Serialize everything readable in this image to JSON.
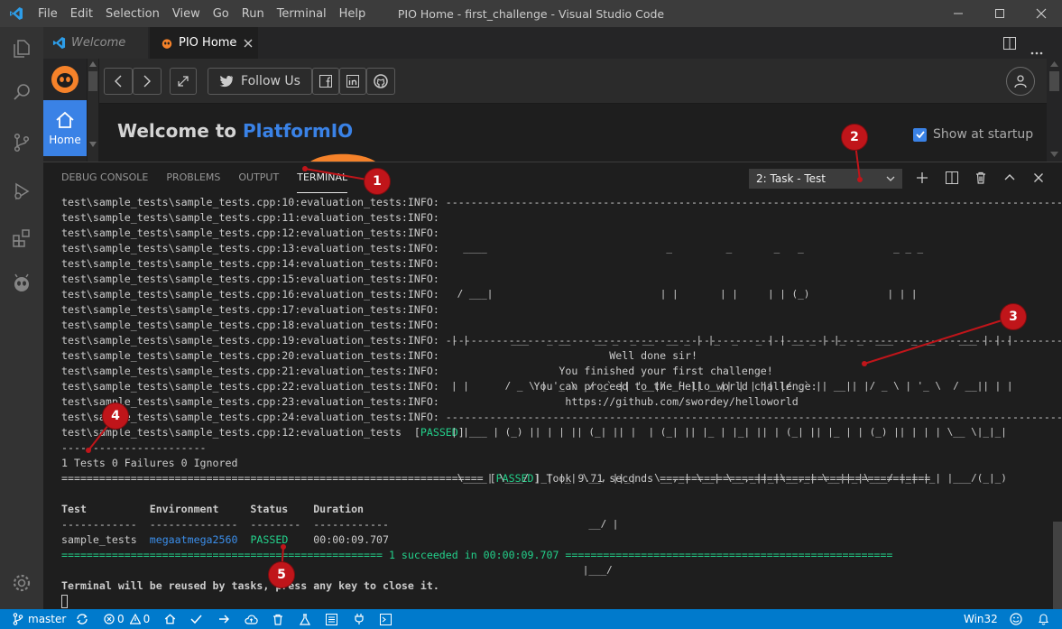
{
  "window": {
    "title": "PIO Home - first_challenge - Visual Studio Code",
    "menu": [
      "File",
      "Edit",
      "Selection",
      "View",
      "Go",
      "Run",
      "Terminal",
      "Help"
    ]
  },
  "tabs": [
    {
      "label": "Welcome",
      "active": false
    },
    {
      "label": "PIO Home",
      "active": true
    }
  ],
  "pio": {
    "home_label": "Home",
    "follow_label": "Follow Us",
    "welcome_prefix": "Welcome to ",
    "welcome_brand": "PlatformIO",
    "show_startup": "Show at startup"
  },
  "panel": {
    "tabs": [
      "DEBUG CONSOLE",
      "PROBLEMS",
      "OUTPUT",
      "TERMINAL"
    ],
    "active_tab": "TERMINAL",
    "task_select": "2: Task - Test"
  },
  "terminal": {
    "prefix_lines": [
      "test\\sample_tests\\sample_tests.cpp:10:evaluation_tests:INFO: ",
      "test\\sample_tests\\sample_tests.cpp:11:evaluation_tests:INFO: ",
      "test\\sample_tests\\sample_tests.cpp:12:evaluation_tests:INFO: ",
      "test\\sample_tests\\sample_tests.cpp:13:evaluation_tests:INFO: ",
      "test\\sample_tests\\sample_tests.cpp:14:evaluation_tests:INFO: ",
      "test\\sample_tests\\sample_tests.cpp:15:evaluation_tests:INFO: ",
      "test\\sample_tests\\sample_tests.cpp:16:evaluation_tests:INFO: ",
      "test\\sample_tests\\sample_tests.cpp:17:evaluation_tests:INFO: ",
      "test\\sample_tests\\sample_tests.cpp:18:evaluation_tests:INFO: ",
      "test\\sample_tests\\sample_tests.cpp:19:evaluation_tests:INFO: ",
      "test\\sample_tests\\sample_tests.cpp:20:evaluation_tests:INFO: ",
      "test\\sample_tests\\sample_tests.cpp:21:evaluation_tests:INFO: ",
      "test\\sample_tests\\sample_tests.cpp:22:evaluation_tests:INFO: ",
      "test\\sample_tests\\sample_tests.cpp:23:evaluation_tests:INFO: ",
      "test\\sample_tests\\sample_tests.cpp:24:evaluation_tests:INFO: "
    ],
    "divider": "--------------------------------------------------------------------------------------------------------",
    "messages": [
      "                          Well done sir!",
      "                  You finished your first challenge!",
      "              You can proceed to the Hello world challenge:",
      "                   https://github.com/swordey/helloworld"
    ],
    "art": [
      "  ____                              _         _       _   _               _ _ _",
      " / ___|                            | |       | |     | | (_)             | | |",
      "| |       ___   _ __    __ _  _ __  __ _ | |_  _   _ | | __ _ | |_  _  ___   _ __    ___ | | |",
      "| |      / _ \\ | '_ \\  / _` || '__|/ _` || __|| | | || |/ _` || __|| |/ _ \\ | '_ \\  / __|| | |",
      "| |___ | (_) || | | || (_| || |  | (_| || |_ | |_| || | (_| || |_ | | (_) || | | | \\__ \\|_|_|",
      " \\____| \\___/ |_| |_| \\__, ||_|   \\__,_| \\__| \\__,_||_|\\__,_| \\__||_|\\___/ |_| |_| |___/(_|_)",
      "                       __/ |",
      "                      |___/"
    ],
    "passed_line_prefix": "test\\sample_tests\\sample_tests.cpp:12:evaluation_tests  [",
    "passed_word": "PASSED",
    "passed_line_suffix": "]",
    "short_dash": "-----------------------",
    "summary": "1 Tests 0 Failures 0 Ignored",
    "took_left": "=================================================================== [",
    "took_right": "] Took 9.71 seconds ===========================================",
    "table_header": "Test          Environment     Status    Duration",
    "table_rule": "------------  --------------  --------  ------------",
    "row_test": "sample_tests  ",
    "row_env": "megaatmega2560",
    "row_status": "PASSED",
    "row_duration": "00:00:09.707",
    "succeeded": "=================================================== 1 succeeded in 00:00:09.707 ====================================================",
    "reuse": "Terminal will be reused by tasks, press any key to close it."
  },
  "status": {
    "branch": "master",
    "problems": "0",
    "warnings": "0",
    "platform": "Win32"
  },
  "annotations": [
    "1",
    "2",
    "3",
    "4",
    "5"
  ]
}
